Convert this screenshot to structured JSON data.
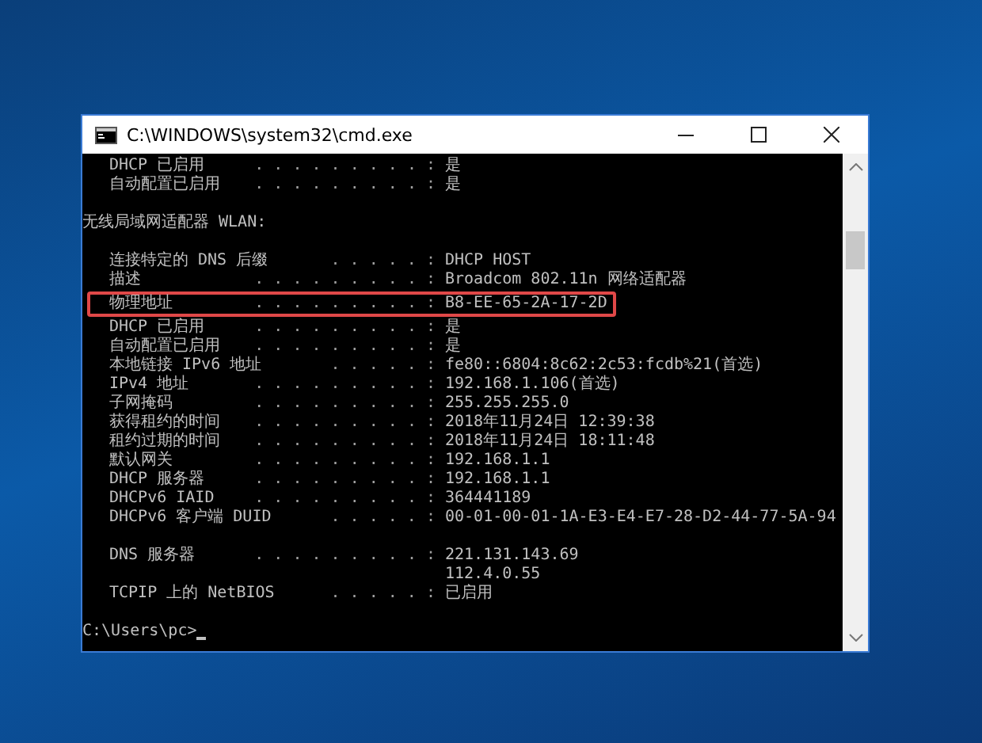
{
  "window": {
    "title": "C:\\WINDOWS\\system32\\cmd.exe"
  },
  "console": {
    "lines": [
      {
        "kind": "entry",
        "label": "DHCP 已启用",
        "leader": ". . . . . . . . . :",
        "value": "是",
        "highlighted": false
      },
      {
        "kind": "entry",
        "label": "自动配置已启用",
        "leader": ". . . . . . . . . :",
        "value": "是",
        "highlighted": false
      },
      {
        "kind": "blank"
      },
      {
        "kind": "heading",
        "text": "无线局域网适配器 WLAN:"
      },
      {
        "kind": "blank"
      },
      {
        "kind": "entry",
        "label": "连接特定的 DNS 后缀",
        "leader": ". . . . . :",
        "value": "DHCP HOST",
        "highlighted": false
      },
      {
        "kind": "entry",
        "label": "描述",
        "leader": ". . . . . . . . . :",
        "value": "Broadcom 802.11n 网络适配器",
        "highlighted": false
      },
      {
        "kind": "entry",
        "label": "物理地址",
        "leader": ". . . . . . . . . :",
        "value": "B8-EE-65-2A-17-2D",
        "highlighted": true
      },
      {
        "kind": "entry",
        "label": "DHCP 已启用",
        "leader": ". . . . . . . . . :",
        "value": "是",
        "highlighted": false
      },
      {
        "kind": "entry",
        "label": "自动配置已启用",
        "leader": ". . . . . . . . . :",
        "value": "是",
        "highlighted": false
      },
      {
        "kind": "entry",
        "label": "本地链接 IPv6 地址",
        "leader": ". . . . . :",
        "value": "fe80::6804:8c62:2c53:fcdb%21(首选)",
        "highlighted": false
      },
      {
        "kind": "entry",
        "label": "IPv4 地址",
        "leader": ". . . . . . . . . :",
        "value": "192.168.1.106(首选)",
        "highlighted": false
      },
      {
        "kind": "entry",
        "label": "子网掩码",
        "leader": ". . . . . . . . . :",
        "value": "255.255.255.0",
        "highlighted": false
      },
      {
        "kind": "entry",
        "label": "获得租约的时间",
        "leader": ". . . . . . . . . :",
        "value": "2018年11月24日 12:39:38",
        "highlighted": false
      },
      {
        "kind": "entry",
        "label": "租约过期的时间",
        "leader": ". . . . . . . . . :",
        "value": "2018年11月24日 18:11:48",
        "highlighted": false
      },
      {
        "kind": "entry",
        "label": "默认网关",
        "leader": ". . . . . . . . . :",
        "value": "192.168.1.1",
        "highlighted": false
      },
      {
        "kind": "entry",
        "label": "DHCP 服务器",
        "leader": ". . . . . . . . . :",
        "value": "192.168.1.1",
        "highlighted": false
      },
      {
        "kind": "entry",
        "label": "DHCPv6 IAID",
        "leader": ". . . . . . . . . :",
        "value": "364441189",
        "highlighted": false
      },
      {
        "kind": "entry",
        "label": "DHCPv6 客户端 DUID",
        "leader": ". . . . . :",
        "value": "00-01-00-01-1A-E3-E4-E7-28-D2-44-77-5A-94",
        "highlighted": false
      },
      {
        "kind": "blank"
      },
      {
        "kind": "entry",
        "label": "DNS 服务器",
        "leader": ". . . . . . . . . :",
        "value": "221.131.143.69",
        "highlighted": false
      },
      {
        "kind": "continuation",
        "value": "112.4.0.55"
      },
      {
        "kind": "entry",
        "label": "TCPIP 上的 NetBIOS",
        "leader": ". . . . . :",
        "value": "已启用",
        "highlighted": false
      },
      {
        "kind": "blank"
      },
      {
        "kind": "prompt",
        "text": "C:\\Users\\pc>"
      }
    ]
  }
}
